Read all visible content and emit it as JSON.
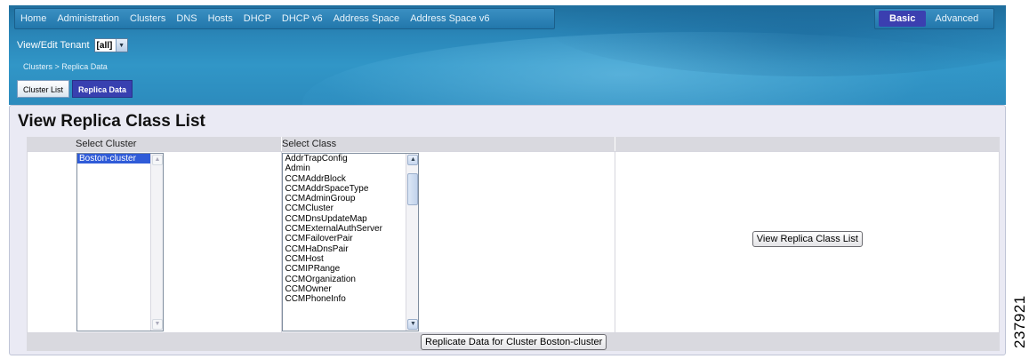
{
  "nav": {
    "items": [
      "Home",
      "Administration",
      "Clusters",
      "DNS",
      "Hosts",
      "DHCP",
      "DHCP v6",
      "Address Space",
      "Address Space v6"
    ]
  },
  "mode": {
    "basic": "Basic",
    "advanced": "Advanced"
  },
  "tenant": {
    "label": "View/Edit Tenant",
    "selected": "[all]"
  },
  "breadcrumb": "Clusters > Replica Data",
  "tabs": [
    {
      "label": "Cluster List",
      "active": false
    },
    {
      "label": "Replica Data",
      "active": true
    }
  ],
  "main": {
    "title": "View Replica Class List",
    "headers": {
      "cluster": "Select Cluster",
      "class": "Select Class"
    },
    "clusters": [
      "Boston-cluster"
    ],
    "selected_cluster": "Boston-cluster",
    "classes": [
      "AddrTrapConfig",
      "Admin",
      "CCMAddrBlock",
      "CCMAddrSpaceType",
      "CCMAdminGroup",
      "CCMCluster",
      "CCMDnsUpdateMap",
      "CCMExternalAuthServer",
      "CCMFailoverPair",
      "CCMHaDnsPair",
      "CCMHost",
      "CCMIPRange",
      "CCMOrganization",
      "CCMOwner",
      "CCMPhoneInfo"
    ],
    "view_button": "View Replica Class List",
    "replicate_button": "Replicate Data for Cluster Boston-cluster"
  },
  "watermark": "237921",
  "colors": {
    "header": "#2a86b8",
    "active_tab": "#3840b0",
    "selection": "#2f5bd8",
    "panel": "#eaeaf4"
  }
}
